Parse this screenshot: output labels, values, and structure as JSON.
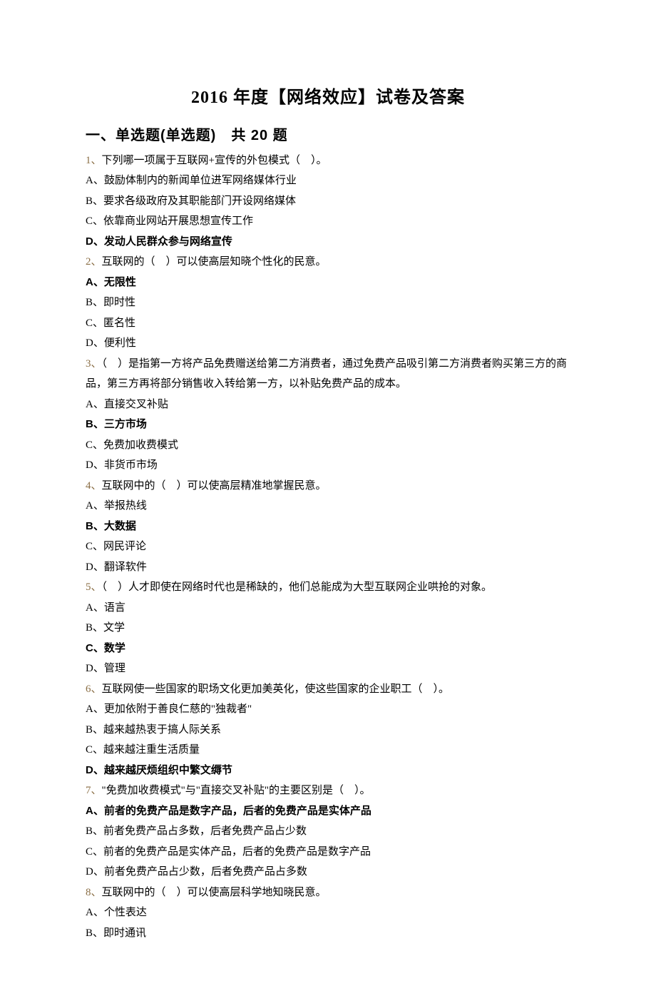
{
  "title": "2016 年度【网络效应】试卷及答案",
  "section": "一、单选题(单选题)　共 20 题",
  "questions": [
    {
      "num": "1、",
      "stem": "下列哪一项属于互联网+宣传的外包模式（　）。",
      "opts": [
        {
          "label": "A、",
          "text": "鼓励体制内的新闻单位进军网络媒体行业",
          "bold": false
        },
        {
          "label": "B、",
          "text": "要求各级政府及其职能部门开设网络媒体",
          "bold": false
        },
        {
          "label": "C、",
          "text": "依靠商业网站开展思想宣传工作",
          "bold": false
        },
        {
          "label": "D、",
          "text": "发动人民群众参与网络宣传",
          "bold": true
        }
      ]
    },
    {
      "num": "2、",
      "stem": "互联网的（　）可以使高层知晓个性化的民意。",
      "opts": [
        {
          "label": "A、",
          "text": "无限性",
          "bold": true
        },
        {
          "label": "B、",
          "text": "即时性",
          "bold": false
        },
        {
          "label": "C、",
          "text": "匿名性",
          "bold": false
        },
        {
          "label": "D、",
          "text": "便利性",
          "bold": false
        }
      ]
    },
    {
      "num": "3、",
      "stem": "（　）是指第一方将产品免费赠送给第二方消费者，通过免费产品吸引第二方消费者购买第三方的商品，第三方再将部分销售收入转给第一方，以补贴免费产品的成本。",
      "opts": [
        {
          "label": "A、",
          "text": "直接交叉补贴",
          "bold": false
        },
        {
          "label": "B、",
          "text": "三方市场",
          "bold": true
        },
        {
          "label": "C、",
          "text": "免费加收费模式",
          "bold": false
        },
        {
          "label": "D、",
          "text": "非货币市场",
          "bold": false
        }
      ]
    },
    {
      "num": "4、",
      "stem": "互联网中的（　）可以使高层精准地掌握民意。",
      "opts": [
        {
          "label": "A、",
          "text": "举报热线",
          "bold": false
        },
        {
          "label": "B、",
          "text": "大数据",
          "bold": true
        },
        {
          "label": "C、",
          "text": "网民评论",
          "bold": false
        },
        {
          "label": "D、",
          "text": "翻译软件",
          "bold": false
        }
      ]
    },
    {
      "num": "5、",
      "stem": "（　）人才即使在网络时代也是稀缺的，他们总能成为大型互联网企业哄抢的对象。",
      "opts": [
        {
          "label": "A、",
          "text": "语言",
          "bold": false
        },
        {
          "label": "B、",
          "text": "文学",
          "bold": false
        },
        {
          "label": "C、",
          "text": "数学",
          "bold": true
        },
        {
          "label": "D、",
          "text": "管理",
          "bold": false
        }
      ]
    },
    {
      "num": "6、",
      "stem": "互联网使一些国家的职场文化更加美英化，使这些国家的企业职工（　）。",
      "opts": [
        {
          "label": "A、",
          "text": "更加依附于善良仁慈的\"独裁者\"",
          "bold": false
        },
        {
          "label": "B、",
          "text": "越来越热衷于搞人际关系",
          "bold": false
        },
        {
          "label": "C、",
          "text": "越来越注重生活质量",
          "bold": false
        },
        {
          "label": "D、",
          "text": "越来越厌烦组织中繁文缛节",
          "bold": true
        }
      ]
    },
    {
      "num": "7、",
      "stem": "\"免费加收费模式\"与\"直接交叉补贴\"的主要区别是（　）。",
      "opts": [
        {
          "label": "A、",
          "text": "前者的免费产品是数字产品，后者的免费产品是实体产品",
          "bold": true
        },
        {
          "label": "B、",
          "text": "前者免费产品占多数，后者免费产品占少数",
          "bold": false
        },
        {
          "label": "C、",
          "text": "前者的免费产品是实体产品，后者的免费产品是数字产品",
          "bold": false
        },
        {
          "label": "D、",
          "text": "前者免费产品占少数，后者免费产品占多数",
          "bold": false
        }
      ]
    },
    {
      "num": "8、",
      "stem": "互联网中的（　）可以使高层科学地知晓民意。",
      "opts": [
        {
          "label": "A、",
          "text": "个性表达",
          "bold": false
        },
        {
          "label": "B、",
          "text": "即时通讯",
          "bold": false
        }
      ]
    }
  ]
}
